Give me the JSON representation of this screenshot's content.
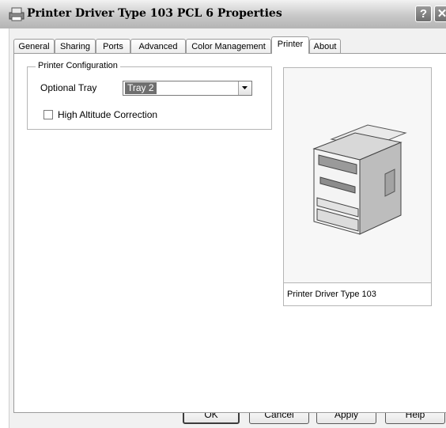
{
  "window": {
    "title": "Printer Driver Type 103 PCL 6 Properties",
    "help_glyph": "?",
    "close_glyph": "✕"
  },
  "tabs": [
    {
      "label": "General"
    },
    {
      "label": "Sharing"
    },
    {
      "label": "Ports"
    },
    {
      "label": "Advanced"
    },
    {
      "label": "Color Management"
    },
    {
      "label": "Printer",
      "active": true
    },
    {
      "label": "About"
    }
  ],
  "printer_config": {
    "group_title": "Printer Configuration",
    "optional_tray_label": "Optional Tray",
    "optional_tray_value": "Tray 2",
    "altitude_label": "High Altitude Correction",
    "altitude_checked": false
  },
  "preview": {
    "caption": "Printer Driver Type 103"
  },
  "buttons": {
    "ok": "OK",
    "cancel": "Cancel",
    "apply": "Apply",
    "help": "Help"
  }
}
